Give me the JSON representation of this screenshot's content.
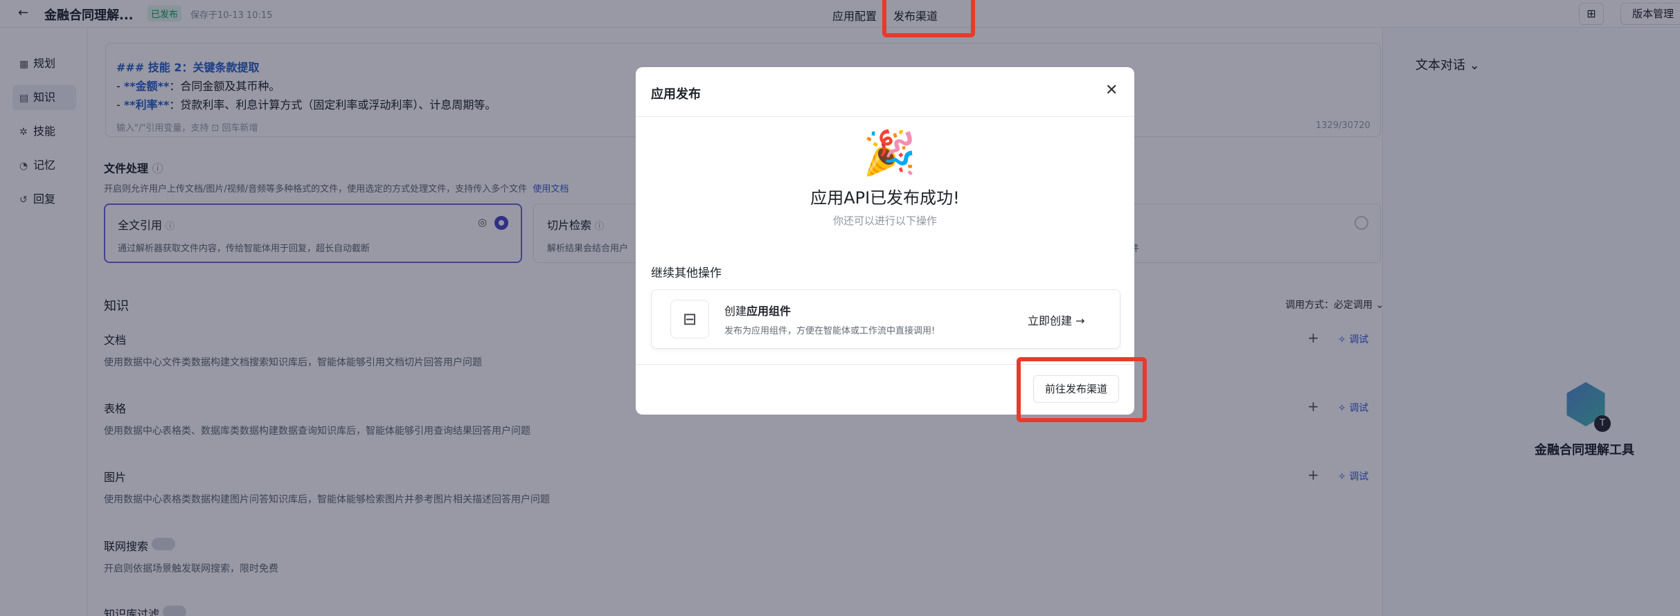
{
  "topbar": {
    "back_icon": "←",
    "app_title": "金融合同理解...",
    "status_badge": "已发布",
    "saved_text": "保存于10-13 10:15",
    "tab_config": "应用配置",
    "tab_channel": "发布渠道",
    "grid_icon": "⊞",
    "version_label": "版本管理"
  },
  "leftnav": {
    "items": [
      {
        "icon": "▦",
        "label": "规划"
      },
      {
        "icon": "▤",
        "label": "知识"
      },
      {
        "icon": "✲",
        "label": "技能"
      },
      {
        "icon": "◔",
        "label": "记忆"
      },
      {
        "icon": "↺",
        "label": "回复"
      }
    ]
  },
  "prompt": {
    "line1_hash": "###",
    "line1_text": " 技能 2：关键条款提取",
    "line2_dash": "- ",
    "line2_bold": "**金额**",
    "line2_rest": "：合同金额及其币种。",
    "line3_dash": "- ",
    "line3_bold": "**利率**",
    "line3_rest": "：贷款利率、利息计算方式（固定利率或浮动利率）、计息周期等。",
    "hint_text": "输入\"/\"引用变量，支持",
    "hint_text2": "回车新增",
    "char_count": "1329/30720"
  },
  "file_processing": {
    "title": "文件处理",
    "desc": "开启则允许用户上传文档/图片/视频/音频等多种格式的文件，使用选定的方式处理文件，支持传入多个文件",
    "link": "使用文档",
    "option1_title": "全文引用",
    "option1_desc": "通过解析器获取文件内容，传给智能体用于回复，超长自动截断",
    "option2_title": "切片检索",
    "option2_desc": "解析结果会结合用户",
    "option3_desc": "件"
  },
  "knowledge": {
    "title": "知识",
    "call_mode": "调用方式：必定调用",
    "debug_label": "调试",
    "plus": "+",
    "docs_title": "文档",
    "docs_desc": "使用数据中心文件类数据构建文档搜索知识库后，智能体能够引用文档切片回答用户问题",
    "table_title": "表格",
    "table_desc": "使用数据中心表格类、数据库类数据构建数据查询知识库后，智能体能够引用查询结果回答用户问题",
    "image_title": "图片",
    "image_desc": "使用数据中心表格类数据构建图片问答知识库后，智能体能够检索图片并参考图片相关描述回答用户问题",
    "web_title": "联网搜索",
    "web_desc": "开启则依据场景触发联网搜索，限时免费",
    "kb_filter_title": "知识库过滤"
  },
  "rightpanel": {
    "title": "文本对话",
    "avatar_badge": "T",
    "app_name": "金融合同理解工具"
  },
  "modal": {
    "title": "应用发布",
    "close_icon": "✕",
    "party_icon": "🎉",
    "success": "应用API已发布成功!",
    "sub": "你还可以进行以下操作",
    "continue": "继续其他操作",
    "comp_icon": "⊟",
    "comp_title_pre": "创建",
    "comp_title_bold": "应用组件",
    "comp_desc": "发布为应用组件，方便在智能体或工作流中直接调用!",
    "comp_go": "立即创建 →",
    "goto_channel": "前往发布渠道"
  }
}
